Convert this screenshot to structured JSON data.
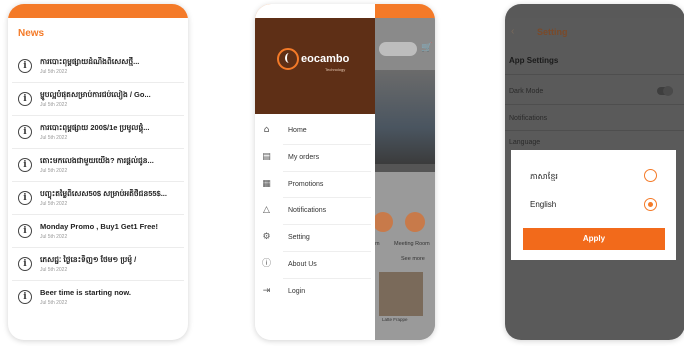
{
  "status_bar": {
    "time": "",
    "battery": ""
  },
  "news": {
    "title": "News",
    "items": [
      {
        "title": "ការបោះពុម្ពផ្សាយដំណឹងពិសេសថ្មី...",
        "date": "Jul 5th 2022"
      },
      {
        "title": "ម្ហូបល្អបំផុតសម្រាប់ការជប់លៀង / Go...",
        "date": "Jul 5th 2022"
      },
      {
        "title": "ការបោះពុម្ពផ្សាយ 200$/1e ប្រមូលផ្ដុំ...",
        "date": "Jul 5th 2022"
      },
      {
        "title": "តោះមកលេងជាមួយយើង? ការផ្ដល់ជូន...",
        "date": "Jul 5th 2022"
      },
      {
        "title": "បញ្ចុះតម្លៃពិសេស50$ សម្រាប់អតិថិជន55$...",
        "date": "Jul 5th 2022"
      },
      {
        "title": "Monday Promo , Buy1 Get1 Free!",
        "date": "Jul 5th 2022"
      },
      {
        "title": "ភេសជ្ជៈ ថ្ងៃនេះទិញ១ ថែម១ ប្រម៉ូ /",
        "date": "Jul 5th 2022"
      },
      {
        "title": "Beer time is starting now.",
        "date": "Jul 5th 2022"
      }
    ]
  },
  "drawer": {
    "logo": "eocambo",
    "logo_sub": "Technology",
    "items": [
      {
        "label": "Home",
        "icon": "home-icon"
      },
      {
        "label": "My orders",
        "icon": "orders-icon"
      },
      {
        "label": "Promotions",
        "icon": "gift-icon"
      },
      {
        "label": "Notifications",
        "icon": "bell-icon"
      },
      {
        "label": "Setting",
        "icon": "gear-icon"
      },
      {
        "label": "About Us",
        "icon": "info-icon"
      },
      {
        "label": "Login",
        "icon": "login-icon"
      }
    ]
  },
  "background_app": {
    "tile_label": "Meeting Room",
    "tile_label_left": "m",
    "see_more": "See more",
    "thumb_label": "Latte Frappe"
  },
  "settings": {
    "title": "Setting",
    "section": "App Settings",
    "rows": [
      "Dark Mode",
      "Notifications",
      "Language"
    ],
    "language_dialog": {
      "options": [
        {
          "label": "ភាសាខ្មែរ",
          "selected": false
        },
        {
          "label": "English",
          "selected": true
        }
      ],
      "apply_label": "Apply"
    }
  },
  "colors": {
    "accent": "#f47a28",
    "drawer_header": "#5e2f16",
    "overlay": "#5a5a5a"
  }
}
